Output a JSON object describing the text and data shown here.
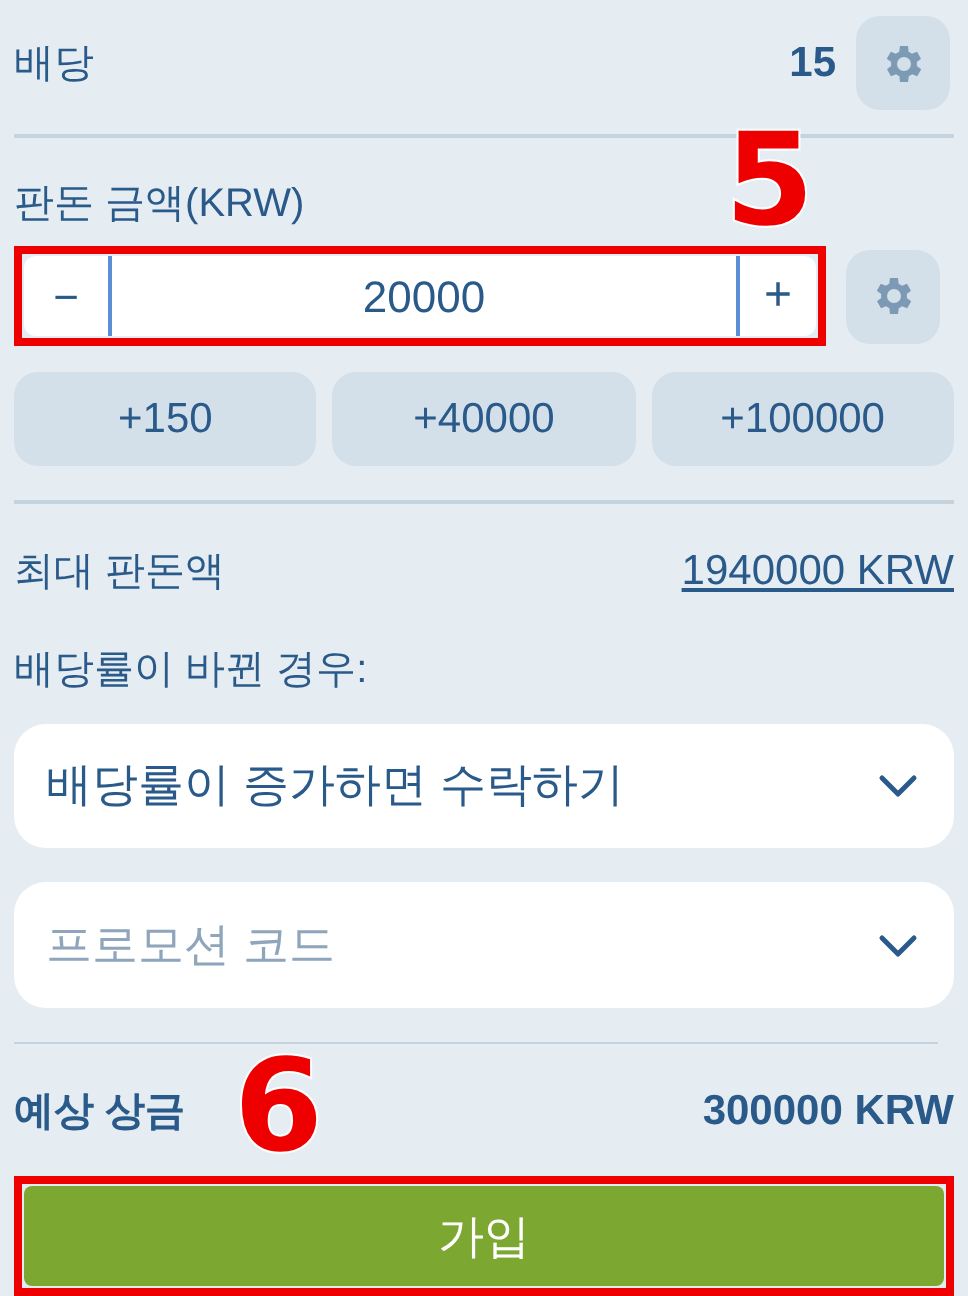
{
  "odds": {
    "label": "배당",
    "value": "15"
  },
  "stake": {
    "label": "판돈 금액(KRW)",
    "minus": "−",
    "value": "20000",
    "plus": "+"
  },
  "quick_amounts": [
    "+150",
    "+40000",
    "+100000"
  ],
  "max_stake": {
    "label": "최대 판돈액",
    "value": "1940000 KRW"
  },
  "odds_change": {
    "label": "배당률이 바뀐 경우:",
    "value": "배당률이 증가하면 수락하기"
  },
  "promo_code": {
    "placeholder": "프로모션 코드"
  },
  "potential_winnings": {
    "label": "예상 상금",
    "value": "300000 KRW"
  },
  "submit": "가입",
  "annotations": [
    {
      "label": "5"
    },
    {
      "label": "6"
    }
  ]
}
